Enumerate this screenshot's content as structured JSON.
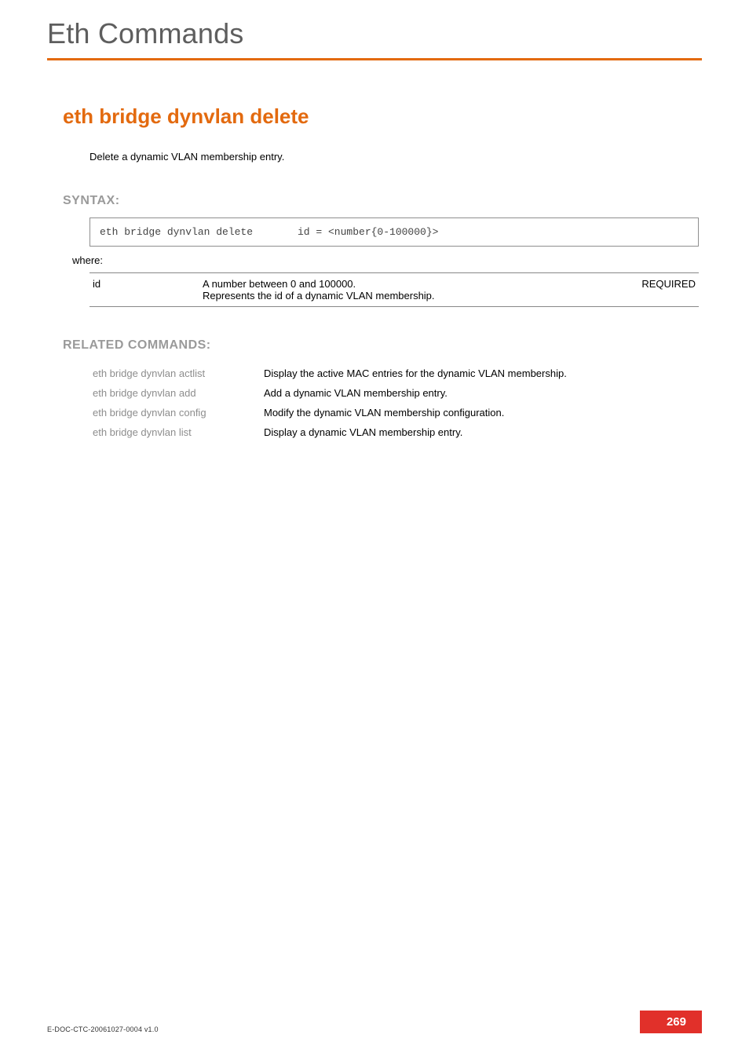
{
  "header": {
    "title": "Eth Commands"
  },
  "command": {
    "title": "eth bridge dynvlan delete",
    "description": "Delete a dynamic VLAN membership entry."
  },
  "syntax": {
    "label": "SYNTAX:",
    "cmd": "eth bridge dynvlan delete",
    "args": "id = <number{0-100000}>",
    "where": "where:",
    "params": [
      {
        "name": "id",
        "desc_line1": "A number between 0 and 100000.",
        "desc_line2": "Represents the id of a dynamic VLAN membership.",
        "req": "REQUIRED"
      }
    ]
  },
  "related": {
    "label": "RELATED COMMANDS:",
    "items": [
      {
        "cmd": "eth bridge dynvlan actlist",
        "desc": "Display the active MAC entries for the dynamic VLAN membership."
      },
      {
        "cmd": "eth bridge dynvlan add",
        "desc": "Add a dynamic VLAN membership entry."
      },
      {
        "cmd": "eth bridge dynvlan config",
        "desc": "Modify the dynamic VLAN membership configuration."
      },
      {
        "cmd": "eth bridge dynvlan list",
        "desc": "Display a dynamic VLAN membership entry."
      }
    ]
  },
  "footer": {
    "docid": "E-DOC-CTC-20061027-0004 v1.0",
    "page": "269"
  }
}
